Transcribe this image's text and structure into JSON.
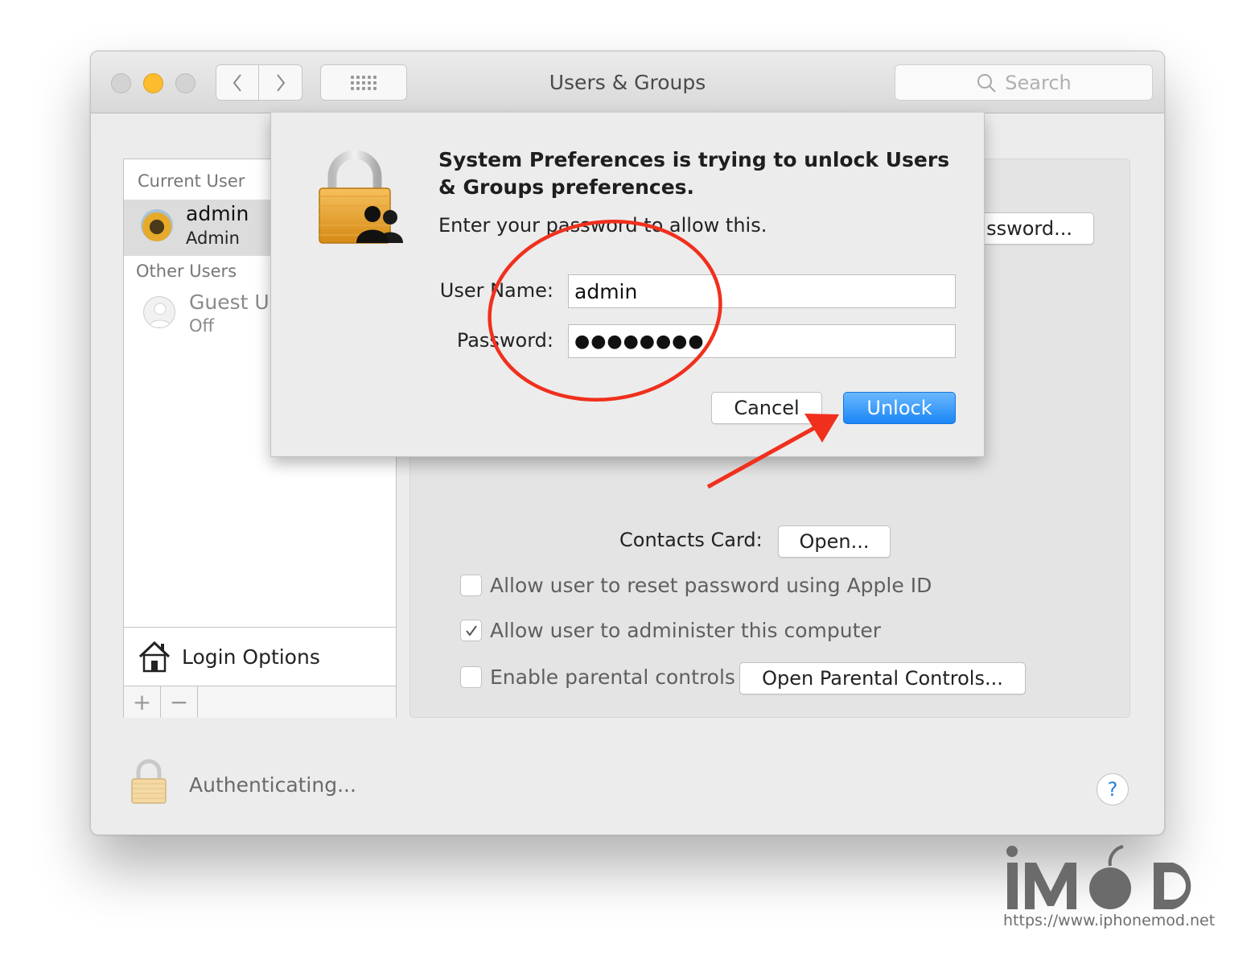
{
  "window": {
    "title": "Users & Groups",
    "search_placeholder": "Search"
  },
  "sidebar": {
    "current_user_label": "Current User",
    "current_user": {
      "name": "admin",
      "role": "Admin"
    },
    "other_users_label": "Other Users",
    "other_users": [
      {
        "name": "Guest Us",
        "status": "Off"
      }
    ],
    "login_options": "Login Options",
    "add_label": "+",
    "remove_label": "−"
  },
  "panel": {
    "change_password_button": "ssword...",
    "contacts_card_label": "Contacts Card:",
    "open_button": "Open...",
    "checkboxes": [
      {
        "label": "Allow user to reset password using Apple ID",
        "checked": false
      },
      {
        "label": "Allow user to administer this computer",
        "checked": true
      },
      {
        "label": "Enable parental controls",
        "checked": false
      }
    ],
    "parental_controls_button": "Open Parental Controls..."
  },
  "footer": {
    "status": "Authenticating...",
    "help": "?"
  },
  "dialog": {
    "title": "System Preferences is trying to unlock Users & Groups preferences.",
    "message": "Enter your password to allow this.",
    "username_label": "User Name:",
    "username_value": "admin",
    "password_label": "Password:",
    "password_value": "●●●●●●●●",
    "cancel_button": "Cancel",
    "unlock_button": "Unlock"
  },
  "colors": {
    "accent_blue": "#1a86f5",
    "annotation_red": "#f0301d",
    "minimize_yellow": "#fdbc2e"
  },
  "watermark": {
    "logo_text": "iMoD",
    "url": "https://www.iphonemod.net"
  }
}
